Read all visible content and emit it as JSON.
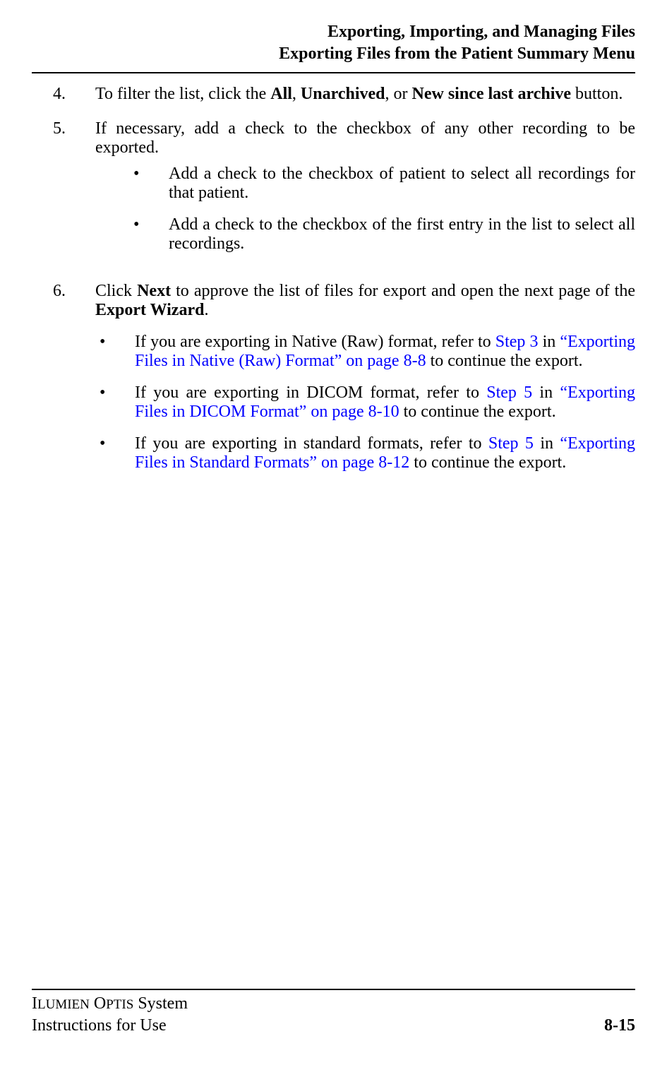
{
  "header": {
    "line1": "Exporting, Importing, and Managing Files",
    "line2": "Exporting Files from the Patient Summary Menu"
  },
  "steps": {
    "s4": {
      "num": "4.",
      "pre": "To filter the list, click the ",
      "b1": "All",
      "sep1": ", ",
      "b2": "Unarchived",
      "sep2": ", or ",
      "b3": "New since last archive",
      "post": " button."
    },
    "s5": {
      "num": "5.",
      "text": "If necessary, add a check to the checkbox of any other recording to be exported.",
      "bullets": [
        "Add a check to the checkbox of patient to select all recordings for that patient.",
        "Add a check to the checkbox of the first entry in the list to select all recordings."
      ]
    },
    "s6": {
      "num": "6.",
      "pre": "Click ",
      "b1": "Next",
      "mid": " to approve the list of files for export and open the next page of the ",
      "b2": "Export Wizard",
      "post": ".",
      "bullets": [
        {
          "pre": "If you are exporting in Native (Raw) format, refer to ",
          "link1": "Step 3",
          "mid1": " in ",
          "link2": "“Exporting Files in Native (Raw) Format” on page 8-8",
          "post": " to continue the export."
        },
        {
          "pre": "If you are exporting in DICOM format, refer to ",
          "link1": "Step 5",
          "mid1": " in ",
          "link2": "“Exporting Files in DICOM Format” on page 8-10",
          "post": " to continue the export."
        },
        {
          "pre": "If you are exporting in standard formats, refer to ",
          "link1": "Step 5",
          "mid1": " in ",
          "link2": "“Exporting Files in Standard Formats” on page 8-12",
          "post": " to continue the export."
        }
      ]
    }
  },
  "footer": {
    "left_line1_a": "I",
    "left_line1_b": "LUMIEN",
    "left_line1_c": " O",
    "left_line1_d": "PTIS",
    "left_line1_e": " System",
    "left_line2": "Instructions for Use",
    "right": "8-15"
  },
  "bullet_char": "•"
}
